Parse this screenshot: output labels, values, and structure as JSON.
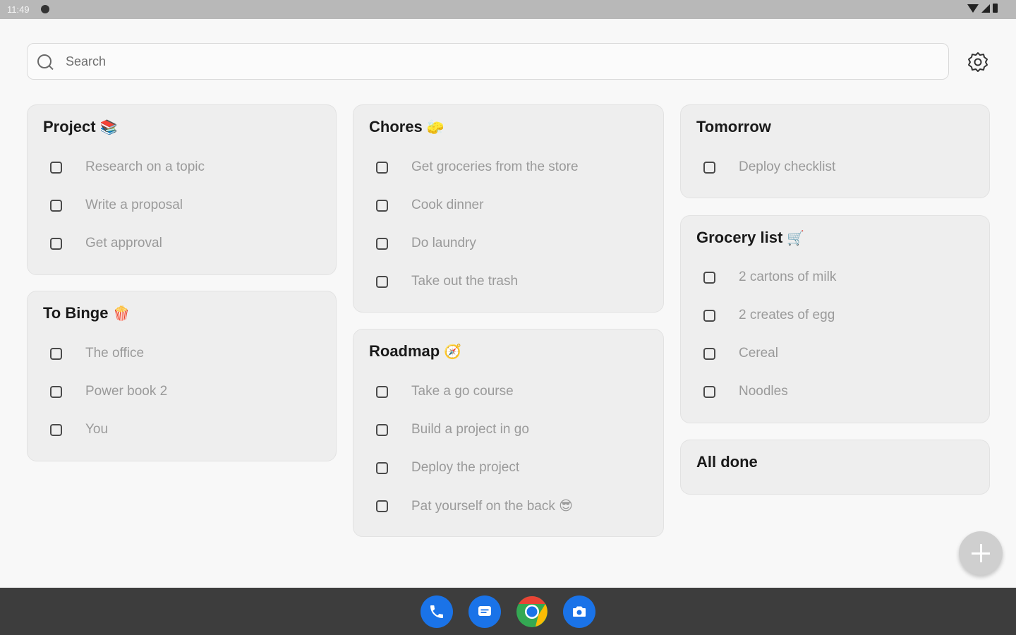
{
  "status_bar": {
    "time": "11:49"
  },
  "search": {
    "placeholder": "Search"
  },
  "colors": {
    "card_bg": "#eeeeee",
    "task_text": "#9a9a9a",
    "dock_bg": "#3d3d3d",
    "fab_bg": "#cfcfcf"
  },
  "lists": {
    "project": {
      "title": "Project",
      "emoji": "📚",
      "tasks": [
        "Research on a topic",
        "Write a proposal",
        "Get approval"
      ]
    },
    "to_binge": {
      "title": "To Binge",
      "emoji": "🍿",
      "tasks": [
        "The office",
        "Power book 2",
        "You"
      ]
    },
    "chores": {
      "title": "Chores",
      "emoji": "🧽",
      "tasks": [
        "Get groceries from the store",
        "Cook dinner",
        "Do laundry",
        "Take out the trash"
      ]
    },
    "roadmap": {
      "title": "Roadmap",
      "emoji": "🧭",
      "tasks": [
        "Take a go course",
        "Build a project in go",
        "Deploy the project",
        "Pat yourself on the back 😎"
      ]
    },
    "tomorrow": {
      "title": "Tomorrow",
      "emoji": "",
      "tasks": [
        "Deploy checklist"
      ]
    },
    "grocery": {
      "title": "Grocery list",
      "emoji": "🛒",
      "tasks": [
        "2 cartons of milk",
        "2 creates of egg",
        "Cereal",
        "Noodles"
      ]
    },
    "all_done": {
      "title": "All done",
      "emoji": "",
      "tasks": []
    }
  },
  "dock": {
    "apps": [
      {
        "name": "phone-app-icon",
        "color": "#1a73e8"
      },
      {
        "name": "messages-app-icon",
        "color": "#1a73e8"
      },
      {
        "name": "chrome-app-icon",
        "color": "#ffffff"
      },
      {
        "name": "camera-app-icon",
        "color": "#1a73e8"
      }
    ]
  }
}
